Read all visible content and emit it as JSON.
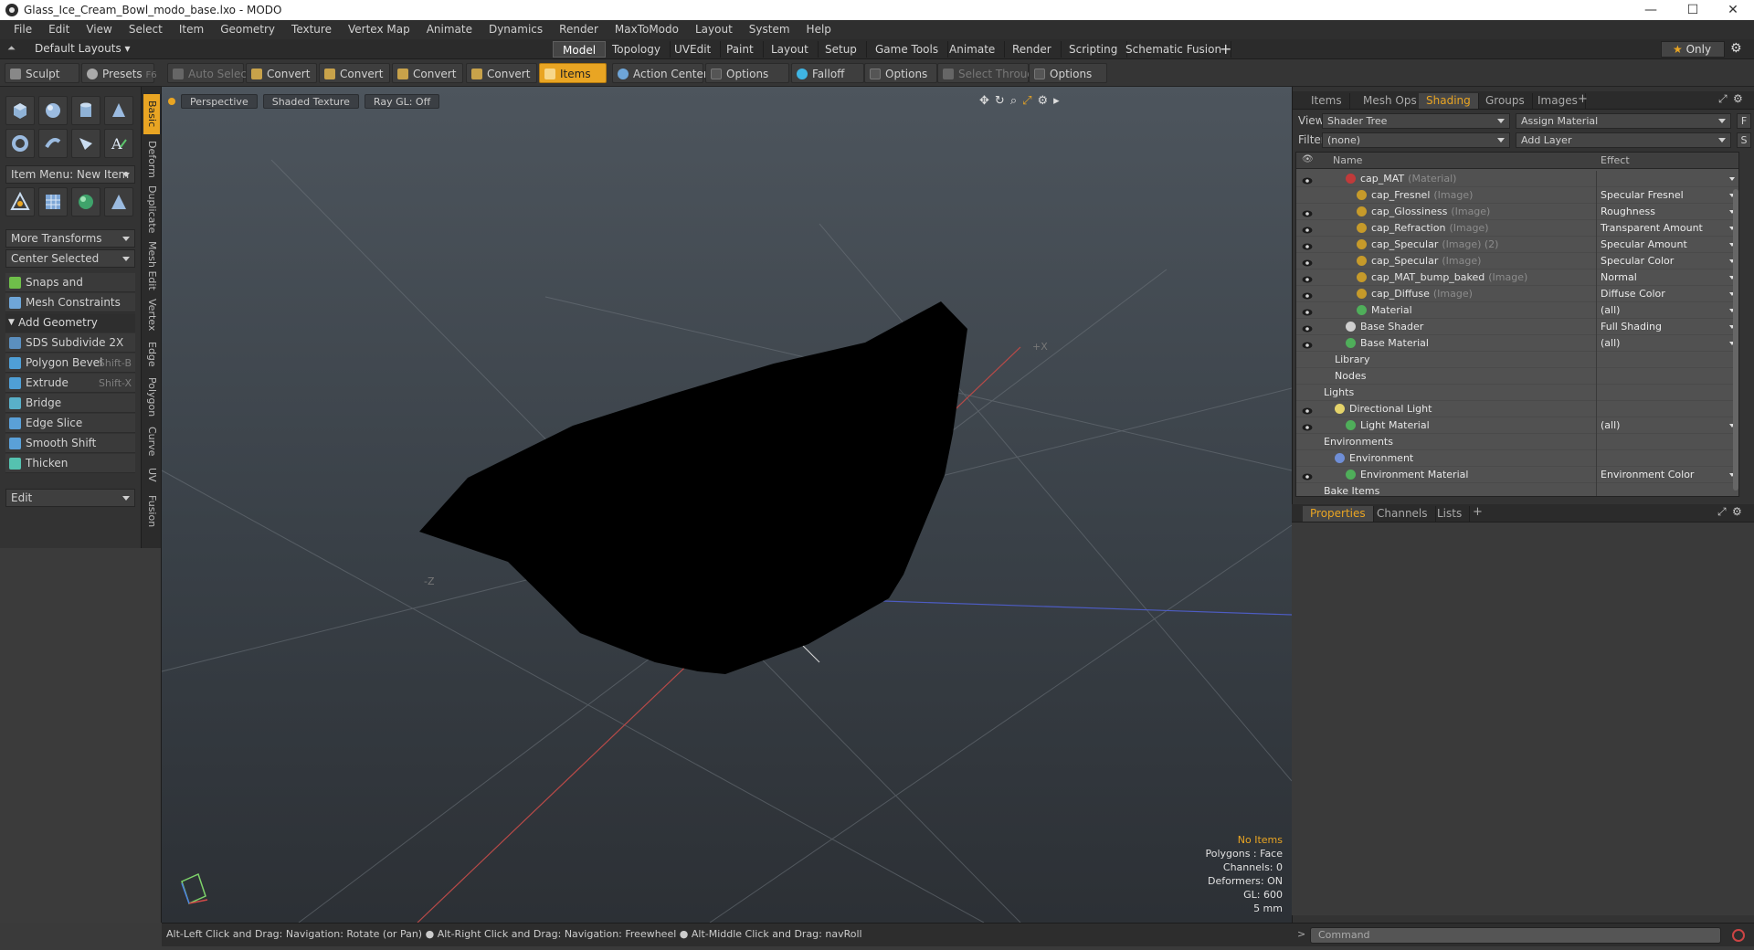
{
  "window": {
    "title": "Glass_Ice_Cream_Bowl_modo_base.lxo - MODO",
    "minimize": "—",
    "maximize": "☐",
    "close": "✕"
  },
  "menu": [
    "File",
    "Edit",
    "View",
    "Select",
    "Item",
    "Geometry",
    "Texture",
    "Vertex Map",
    "Animate",
    "Dynamics",
    "Render",
    "MaxToModo",
    "Layout",
    "System",
    "Help"
  ],
  "layouts": {
    "default_label": "Default Layouts",
    "tabs": [
      "Model",
      "Topology",
      "UVEdit",
      "Paint",
      "Layout",
      "Setup",
      "Game Tools",
      "Animate",
      "Render",
      "Scripting",
      "Schematic Fusion"
    ],
    "active": "Model",
    "plus": "+",
    "only_label": "Only"
  },
  "toolbar": {
    "sculpt": "Sculpt",
    "presets": "Presets",
    "presets_key": "F6",
    "auto_select": "Auto Select",
    "convert1": "Convert",
    "convert2": "Convert",
    "convert3": "Convert",
    "convert4": "Convert",
    "items": "Items",
    "action_center": "Action Center",
    "options1": "Options",
    "falloff": "Falloff",
    "options2": "Options",
    "select_through": "Select Through",
    "options3": "Options"
  },
  "left_tabs": [
    "Basic",
    "Deform",
    "Duplicate",
    "Mesh Edit",
    "Vertex",
    "Edge",
    "Polygon",
    "Curve",
    "UV",
    "Fusion"
  ],
  "left": {
    "item_menu": "Item Menu: New Item",
    "more_transforms": "More Transforms",
    "center_selected": "Center Selected",
    "snaps": "Snaps and Precision",
    "mesh_constraints": "Mesh Constraints",
    "add_geometry": "Add Geometry",
    "tools": [
      {
        "label": "SDS Subdivide 2X",
        "key": "",
        "color": "#5b8fbf"
      },
      {
        "label": "Polygon Bevel",
        "key": "Shift-B",
        "color": "#4f9fd6"
      },
      {
        "label": "Extrude",
        "key": "Shift-X",
        "color": "#4f9fd6"
      },
      {
        "label": "Bridge",
        "key": "",
        "color": "#59b0c9"
      },
      {
        "label": "Edge Slice",
        "key": "",
        "color": "#5aa0d8"
      },
      {
        "label": "Smooth Shift",
        "key": "",
        "color": "#5aa0d8"
      },
      {
        "label": "Thicken",
        "key": "",
        "color": "#55c2b0"
      }
    ],
    "edit": "Edit"
  },
  "viewport": {
    "perspective": "Perspective",
    "shaded": "Shaded Texture",
    "raygl": "Ray GL: Off",
    "no_items": "No Items",
    "polygons": "Polygons : Face",
    "channels": "Channels: 0",
    "deformers": "Deformers: ON",
    "gl": "GL: 600",
    "scale": "5 mm",
    "axis_x": "+X",
    "axis_z": "-Z"
  },
  "status": "Alt-Left Click and Drag: Navigation: Rotate (or Pan) ● Alt-Right Click and Drag: Navigation: Freewheel ● Alt-Middle Click and Drag: navRoll",
  "right": {
    "tabs": [
      "Items",
      "Mesh Ops",
      "Shading",
      "Groups",
      "Images"
    ],
    "active_tab": "Shading",
    "view_label": "View",
    "view_value": "Shader Tree",
    "assign_material": "Assign Material",
    "filter_label": "Filter",
    "filter_value": "(none)",
    "add_layer": "Add Layer",
    "f_btn": "F",
    "s_btn": "S",
    "col_name": "Name",
    "col_effect": "Effect",
    "rows": [
      {
        "name": "cap_MAT",
        "type": "(Material)",
        "effect": "",
        "indent": 2,
        "icon": "#c03a3a",
        "eye": true,
        "dd": true
      },
      {
        "name": "cap_Fresnel",
        "type": "(Image)",
        "effect": "Specular Fresnel",
        "indent": 3,
        "icon": "#c69a2a",
        "eye": false,
        "dd": true
      },
      {
        "name": "cap_Glossiness",
        "type": "(Image)",
        "effect": "Roughness",
        "indent": 3,
        "icon": "#c69a2a",
        "eye": true,
        "dd": true
      },
      {
        "name": "cap_Refraction",
        "type": "(Image)",
        "effect": "Transparent Amount",
        "indent": 3,
        "icon": "#c69a2a",
        "eye": true,
        "dd": true
      },
      {
        "name": "cap_Specular",
        "type": "(Image) (2)",
        "effect": "Specular Amount",
        "indent": 3,
        "icon": "#c69a2a",
        "eye": true,
        "dd": true
      },
      {
        "name": "cap_Specular",
        "type": "(Image)",
        "effect": "Specular Color",
        "indent": 3,
        "icon": "#c69a2a",
        "eye": true,
        "dd": true
      },
      {
        "name": "cap_MAT_bump_baked",
        "type": "(Image)",
        "effect": "Normal",
        "indent": 3,
        "icon": "#c69a2a",
        "eye": true,
        "dd": true
      },
      {
        "name": "cap_Diffuse",
        "type": "(Image)",
        "effect": "Diffuse Color",
        "indent": 3,
        "icon": "#c69a2a",
        "eye": true,
        "dd": true
      },
      {
        "name": "Material",
        "type": "",
        "effect": "(all)",
        "indent": 3,
        "icon": "#4fae5a",
        "eye": true,
        "dd": true
      },
      {
        "name": "Base Shader",
        "type": "",
        "effect": "Full Shading",
        "indent": 2,
        "icon": "#cfcfcf",
        "eye": true,
        "dd": true
      },
      {
        "name": "Base Material",
        "type": "",
        "effect": "(all)",
        "indent": 2,
        "icon": "#4fae5a",
        "eye": true,
        "dd": true
      },
      {
        "name": "Library",
        "type": "",
        "effect": "",
        "indent": 1,
        "icon": "",
        "eye": false,
        "dd": false
      },
      {
        "name": "Nodes",
        "type": "",
        "effect": "",
        "indent": 1,
        "icon": "",
        "eye": false,
        "dd": false
      },
      {
        "name": "Lights",
        "type": "",
        "effect": "",
        "indent": 0,
        "icon": "",
        "eye": false,
        "dd": false
      },
      {
        "name": "Directional Light",
        "type": "",
        "effect": "",
        "indent": 1,
        "icon": "#e4d36a",
        "eye": true,
        "dd": false
      },
      {
        "name": "Light Material",
        "type": "",
        "effect": "(all)",
        "indent": 2,
        "icon": "#4fae5a",
        "eye": true,
        "dd": true
      },
      {
        "name": "Environments",
        "type": "",
        "effect": "",
        "indent": 0,
        "icon": "",
        "eye": false,
        "dd": false
      },
      {
        "name": "Environment",
        "type": "",
        "effect": "",
        "indent": 1,
        "icon": "#6f8ed6",
        "eye": false,
        "dd": false
      },
      {
        "name": "Environment Material",
        "type": "",
        "effect": "Environment Color",
        "indent": 2,
        "icon": "#4fae5a",
        "eye": true,
        "dd": true
      },
      {
        "name": "Bake Items",
        "type": "",
        "effect": "",
        "indent": 0,
        "icon": "",
        "eye": false,
        "dd": false
      }
    ],
    "lower_tabs": [
      "Properties",
      "Channels",
      "Lists"
    ],
    "lower_active": "Properties",
    "command_placeholder": "Command"
  }
}
